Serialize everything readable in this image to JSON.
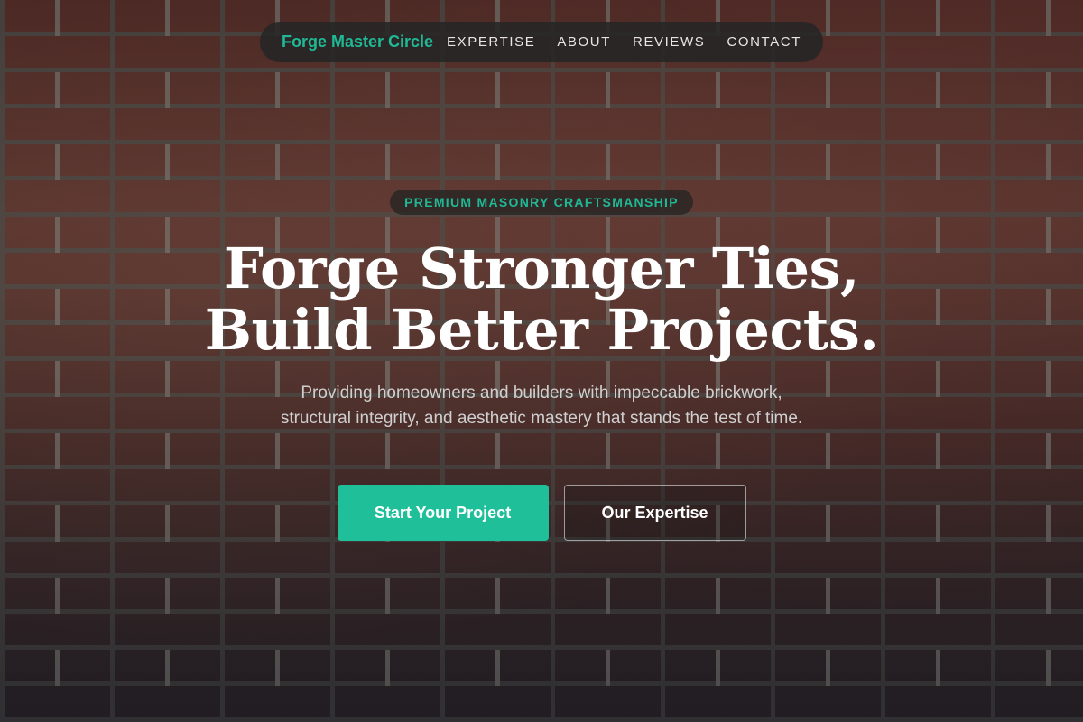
{
  "colors": {
    "accent": "#1fbf9a",
    "brand_text": "#1fb995",
    "nav_background": "#262626",
    "headline": "#ffffff"
  },
  "nav": {
    "brand": "Forge Master Circle",
    "links": [
      {
        "label": "EXPERTISE"
      },
      {
        "label": "ABOUT"
      },
      {
        "label": "REVIEWS"
      },
      {
        "label": "CONTACT"
      }
    ]
  },
  "hero": {
    "badge": "PREMIUM MASONRY CRAFTSMANSHIP",
    "headline_line1": "Forge Stronger Ties,",
    "headline_line2": "Build Better Projects.",
    "subtext_line1": "Providing homeowners and builders with impeccable brickwork,",
    "subtext_line2": "structural integrity, and aesthetic mastery that stands the test of time.",
    "primary_cta": "Start Your Project",
    "secondary_cta": "Our Expertise"
  }
}
